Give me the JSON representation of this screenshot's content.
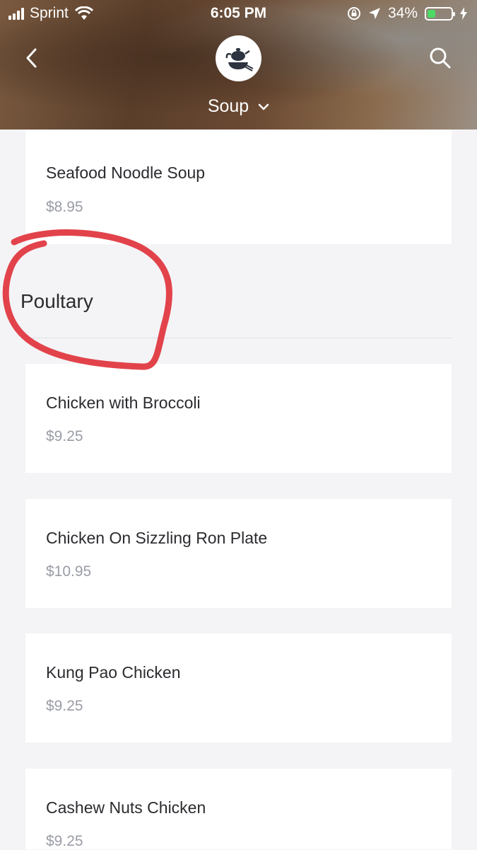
{
  "status_bar": {
    "carrier": "Sprint",
    "time": "6:05 PM",
    "battery_percent": "34%",
    "battery_level": 0.34,
    "battery_color": "#4cd964"
  },
  "header": {
    "category_label": "Soup",
    "back_icon": "chevron-left-icon",
    "search_icon": "search-icon",
    "logo_icon": "teapot-bowl-logo"
  },
  "section": {
    "title": "Poultary"
  },
  "menu_items": [
    {
      "name": "Seafood Noodle Soup",
      "price": "$8.95"
    },
    {
      "name": "Chicken with Broccoli",
      "price": "$9.25"
    },
    {
      "name": "Chicken On Sizzling Ron Plate",
      "price": "$10.95"
    },
    {
      "name": "Kung Pao Chicken",
      "price": "$9.25"
    },
    {
      "name": "Cashew Nuts Chicken",
      "price": "$9.25"
    }
  ],
  "annotation_color": "#e2434b"
}
